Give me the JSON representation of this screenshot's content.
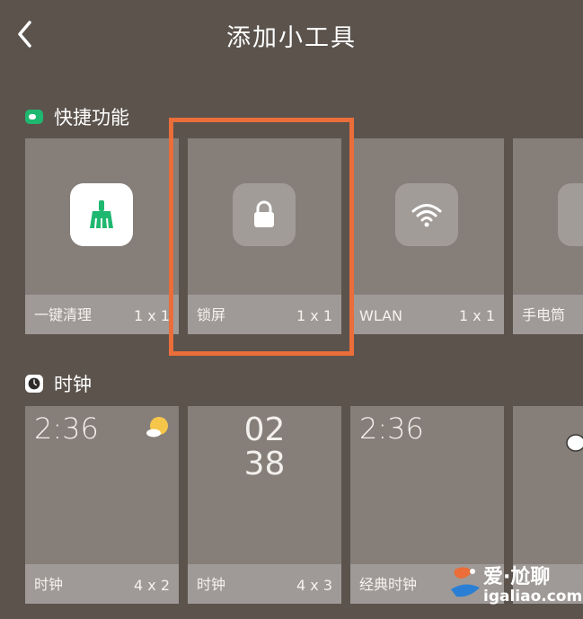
{
  "header": {
    "title": "添加小工具"
  },
  "sections": [
    {
      "title": "快捷功能",
      "items": [
        {
          "name": "一键清理",
          "size": "1 x 1",
          "icon": "broom-icon"
        },
        {
          "name": "锁屏",
          "size": "1 x 1",
          "icon": "lock-icon"
        },
        {
          "name": "WLAN",
          "size": "1 x 1",
          "icon": "wifi-icon"
        },
        {
          "name": "手电筒",
          "size": "",
          "icon": "flashlight-icon"
        }
      ]
    },
    {
      "title": "时钟",
      "items": [
        {
          "name": "时钟",
          "size": "4 x 2",
          "time": "2:36",
          "icon": "weather-sun-cloud-icon"
        },
        {
          "name": "时钟",
          "size": "4 x 3",
          "hour": "02",
          "minute": "38"
        },
        {
          "name": "经典时钟",
          "size": "",
          "time": "2:36"
        },
        {
          "name": "",
          "size": "",
          "icon": "weather-cloud-icon"
        }
      ]
    }
  ],
  "watermark": {
    "line1": "爱·尬聊",
    "line2": "igaliao.com"
  },
  "colors": {
    "background": "#5b534c",
    "highlight": "#ea6d3a",
    "accent_green": "#1fb870"
  }
}
